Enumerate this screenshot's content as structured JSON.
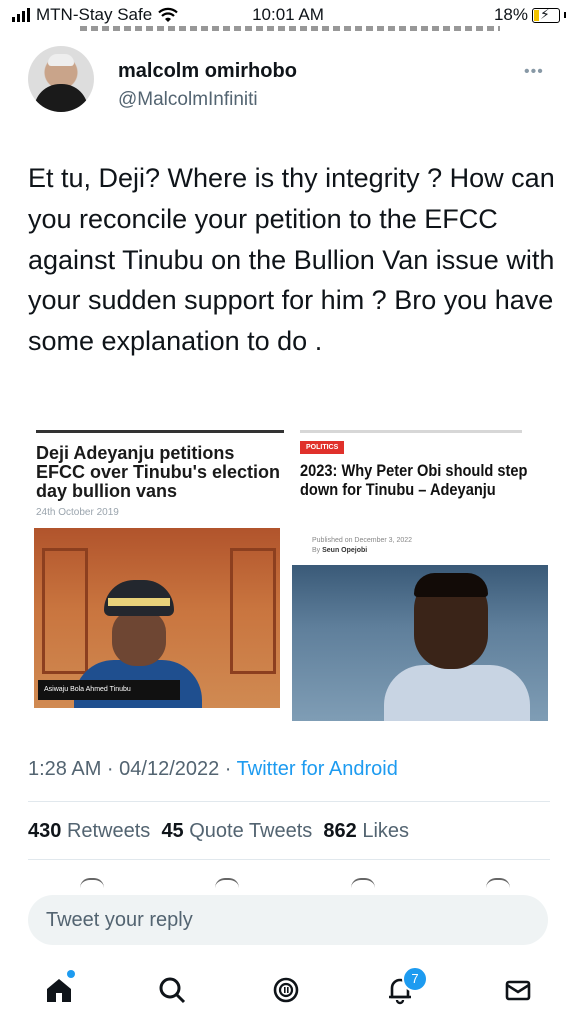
{
  "status_bar": {
    "carrier": "MTN-Stay Safe",
    "time": "10:01 AM",
    "battery": "18%"
  },
  "tweet": {
    "author_name": "malcolm omirhobo",
    "author_handle": "@MalcolmInfiniti",
    "more_label": "•••",
    "text": "Et tu, Deji? Where is thy integrity ? How can you reconcile your petition to the EFCC  against Tinubu on the Bullion Van issue with your sudden support for him ?  Bro you have some explanation to do .",
    "timestamp": "1:28 AM · 04/12/2022 · ",
    "source_app": "Twitter for Android",
    "retweets_count": "430",
    "retweets_label": "Retweets",
    "quotes_count": "45",
    "quotes_label": "Quote Tweets",
    "likes_count": "862",
    "likes_label": "Likes"
  },
  "media": {
    "card1": {
      "headline": "Deji Adeyanju petitions EFCC over Tinubu's election day bullion vans",
      "date": "24th October 2019",
      "photo_caption": "Asiwaju Bola Ahmed Tinubu"
    },
    "card2": {
      "tag": "POLITICS",
      "headline": "2023: Why Peter Obi should step down for Tinubu – Adeyanju",
      "published": "Published on December 3, 2022",
      "author_prefix": "By ",
      "author": "Seun Opejobi"
    }
  },
  "reply": {
    "placeholder": "Tweet your reply"
  },
  "nav": {
    "items": [
      "home-icon",
      "search-icon",
      "spaces-icon",
      "notifications-icon",
      "messages-icon"
    ],
    "notification_count": "7"
  },
  "colors": {
    "accent": "#1d9bf0",
    "text": "#0f1419",
    "muted": "#536471",
    "politics_tag": "#e0312b"
  }
}
